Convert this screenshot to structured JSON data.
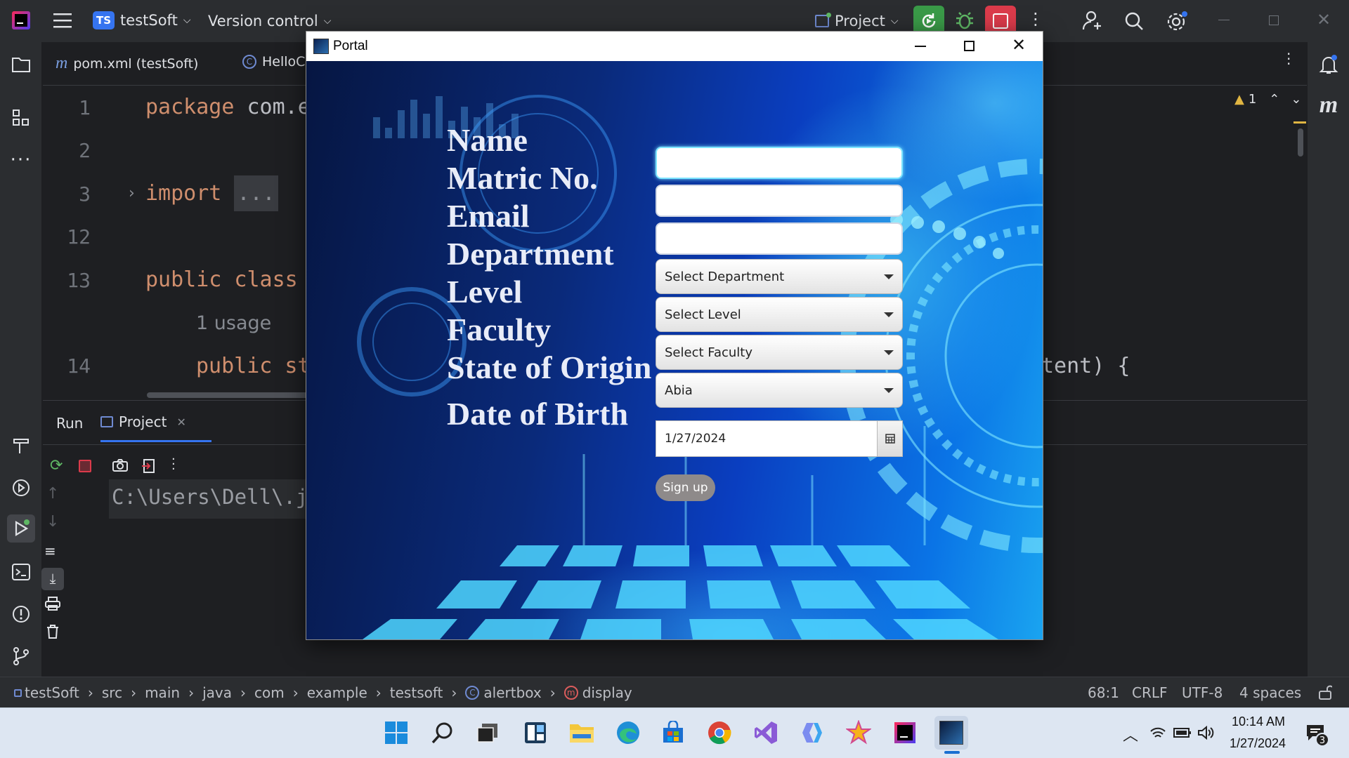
{
  "ide": {
    "project": {
      "badge": "TS",
      "name": "testSoft"
    },
    "vcs_label": "Version control",
    "run_config": "Project",
    "editor_tabs": [
      "pom.xml (testSoft)",
      "HelloC"
    ],
    "code": {
      "line_numbers": [
        "1",
        "2",
        "3",
        "12",
        "13",
        "",
        "14"
      ],
      "l1_kw": "package",
      "l1_rest": " com.e",
      "l3_kw": "import",
      "l3_fold": "...",
      "l13": "public class",
      "usage": "1 usage",
      "l14": "public st",
      "l14_tail": "tent) {"
    },
    "warnings_count": "1",
    "run_panel": {
      "tab_run": "Run",
      "tab_project": "Project",
      "console_text": "C:\\Users\\Dell\\.j"
    },
    "breadcrumbs": [
      "testSoft",
      "src",
      "main",
      "java",
      "com",
      "example",
      "testsoft",
      "alertbox",
      "display"
    ],
    "status_right": {
      "position": "68:1",
      "line_sep": "CRLF",
      "encoding": "UTF-8",
      "indent": "4 spaces"
    }
  },
  "portal": {
    "title": "Portal",
    "labels": {
      "name": "Name",
      "matric": "Matric No.",
      "email": "Email",
      "department": "Department",
      "level": "Level",
      "faculty": "Faculty",
      "state": "State of Origin",
      "dob": "Date of Birth"
    },
    "inputs": {
      "name": "",
      "matric": "",
      "email": ""
    },
    "selects": {
      "department": "Select Department",
      "level": "Select Level",
      "faculty": "Select Faculty",
      "state": "Abia"
    },
    "dob_value": "1/27/2024",
    "submit_label": "Sign up"
  },
  "taskbar": {
    "time": "10:14 AM",
    "date": "1/27/2024",
    "notif_count": "3"
  },
  "colors": {
    "accent_green": "#3a9a48",
    "stop_red": "#db3b4b",
    "keyword": "#cf8e6d"
  }
}
